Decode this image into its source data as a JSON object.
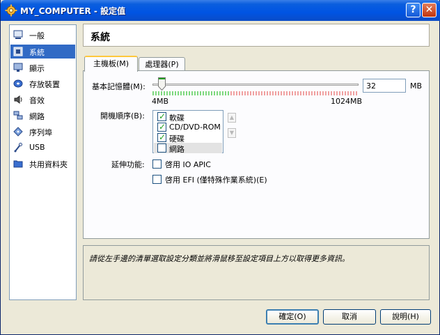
{
  "window": {
    "title": "MY_COMPUTER - 設定值",
    "help_label": "?",
    "close_label": "✕"
  },
  "sidebar": {
    "items": [
      {
        "label": "一般",
        "icon": "computer-icon",
        "selected": false
      },
      {
        "label": "系統",
        "icon": "chip-icon",
        "selected": true
      },
      {
        "label": "顯示",
        "icon": "monitor-icon",
        "selected": false
      },
      {
        "label": "存放裝置",
        "icon": "disk-icon",
        "selected": false
      },
      {
        "label": "音效",
        "icon": "speaker-icon",
        "selected": false
      },
      {
        "label": "網路",
        "icon": "network-icon",
        "selected": false
      },
      {
        "label": "序列埠",
        "icon": "serial-port-icon",
        "selected": false
      },
      {
        "label": "USB",
        "icon": "usb-icon",
        "selected": false
      },
      {
        "label": "共用資料夾",
        "icon": "folder-icon",
        "selected": false
      }
    ]
  },
  "header": {
    "title": "系統"
  },
  "tabs": [
    {
      "label": "主機板(M)",
      "active": true
    },
    {
      "label": "處理器(P)",
      "active": false
    }
  ],
  "motherboard": {
    "memory_label": "基本記憶體(M):",
    "memory_value": "32",
    "memory_unit": "MB",
    "memory_min_label": "4MB",
    "memory_max_label": "1024MB",
    "slider_fraction": 0.027,
    "boot_order_label": "開機順序(B):",
    "boot_items": [
      {
        "label": "軟碟",
        "checked": true,
        "selected": false
      },
      {
        "label": "CD/DVD-ROM",
        "checked": true,
        "selected": false
      },
      {
        "label": "硬碟",
        "checked": true,
        "selected": false
      },
      {
        "label": "網路",
        "checked": false,
        "selected": true
      }
    ],
    "up_arrow": "▲",
    "down_arrow": "▼",
    "extended_label": "延伸功能:",
    "ioapic_label": "啓用 IO APIC",
    "ioapic_checked": false,
    "efi_label": "啓用 EFI (僅特殊作業系統)(E)",
    "efi_checked": false
  },
  "description": "請從左手邊的清單選取設定分類並將滑鼠移至設定項目上方以取得更多資訊。",
  "buttons": {
    "ok": "確定(O)",
    "cancel": "取消",
    "help": "說明(H)"
  },
  "colors": {
    "titlebar": "#0054e3",
    "selection": "#316ac5",
    "check_mark": "#21a121"
  }
}
